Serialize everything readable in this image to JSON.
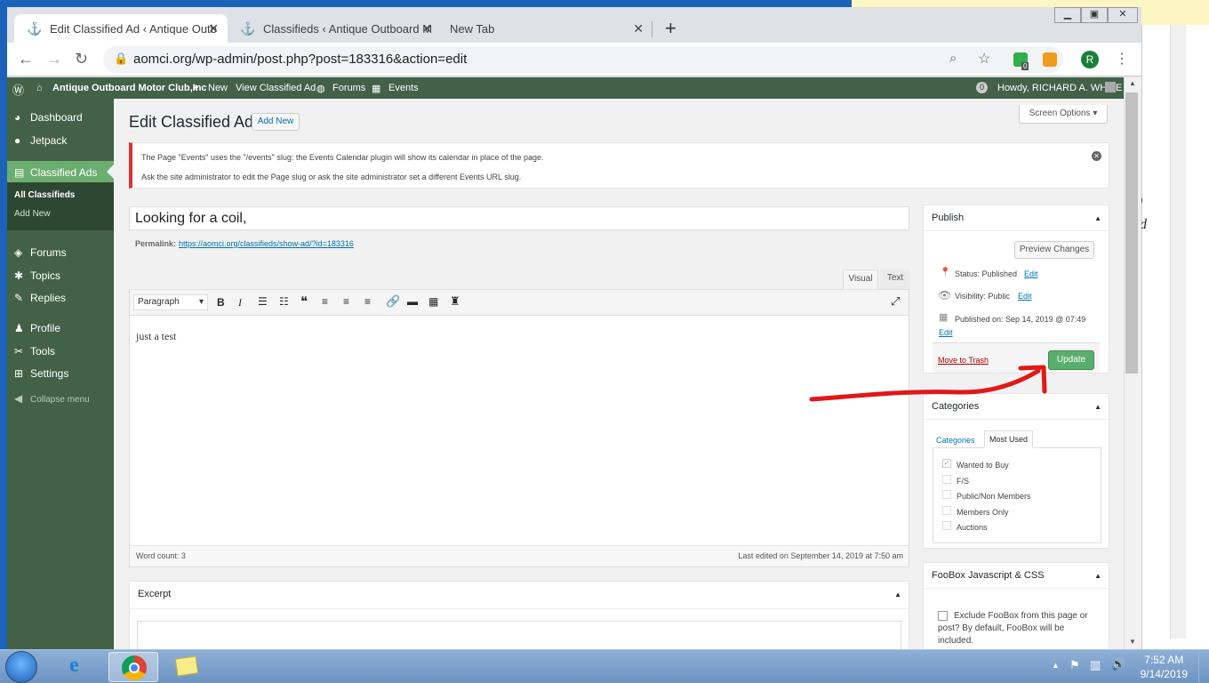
{
  "browser": {
    "tabs": [
      {
        "label": "Edit Classified Ad ‹ Antique Outb",
        "active": true
      },
      {
        "label": "Classifieds ‹ Antique Outboard M",
        "active": false
      },
      {
        "label": "New Tab",
        "active": false
      }
    ],
    "url": "aomci.org/wp-admin/post.php?post=183316&action=edit",
    "profile_initial": "R",
    "extension_badge": "0"
  },
  "adminbar": {
    "site": "Antique Outboard Motor Club,Inc",
    "new": "New",
    "view": "View Classified Ad",
    "forums": "Forums",
    "events": "Events",
    "notif": "0",
    "howdy": "Howdy, RICHARD A. WHITE"
  },
  "sidebar": {
    "items": [
      "Dashboard",
      "Jetpack",
      "Classified Ads",
      "Forums",
      "Topics",
      "Replies",
      "Profile",
      "Tools",
      "Settings",
      "Collapse menu"
    ],
    "sub": [
      "All Classifieds",
      "Add New"
    ]
  },
  "header": {
    "title": "Edit Classified Ad",
    "add_new": "Add New",
    "screen_options": "Screen Options"
  },
  "notice": {
    "line1": "The Page \"Events\" uses the \"/events\" slug: the Events Calendar plugin will show its calendar in place of the page.",
    "line2": "Ask the site administrator to edit the Page slug or ask the site administrator set a different Events URL slug."
  },
  "post": {
    "title": "Looking for a coil,",
    "permalink_label": "Permalink:",
    "permalink": "https://aomci.org/classifieds/show-ad/?id=183316",
    "tab_visual": "Visual",
    "tab_text": "Text",
    "format": "Paragraph",
    "body": "just a test",
    "word_count": "Word count: 3",
    "last_edited": "Last edited on September 14, 2019 at 7:50 am"
  },
  "excerpt": {
    "title": "Excerpt"
  },
  "publish": {
    "title": "Publish",
    "preview": "Preview Changes",
    "status": "Status: Published",
    "visibility": "Visibility: Public",
    "published_on": "Published on: Sep 14, 2019 @ 07:49",
    "edit": "Edit",
    "trash": "Move to Trash",
    "update": "Update"
  },
  "categories": {
    "title": "Categories",
    "tab_all": "Categories",
    "tab_used": "Most Used",
    "items": [
      {
        "label": "Wanted to Buy",
        "checked": true
      },
      {
        "label": "F/S",
        "checked": false
      },
      {
        "label": "Public/Non Members",
        "checked": false
      },
      {
        "label": "Members Only",
        "checked": false
      },
      {
        "label": "Auctions",
        "checked": false
      }
    ]
  },
  "foobox": {
    "title": "FooBox Javascript & CSS",
    "label": "Exclude FooBox from this page or post? By default, FooBox will be included."
  },
  "taskbar": {
    "time": "7:52 AM",
    "date": "9/14/2019"
  },
  "colors": {
    "admin_green": "#426146",
    "active_green": "#6cae70",
    "update_btn": "#5aae6d",
    "annotation_red": "#e01818"
  }
}
